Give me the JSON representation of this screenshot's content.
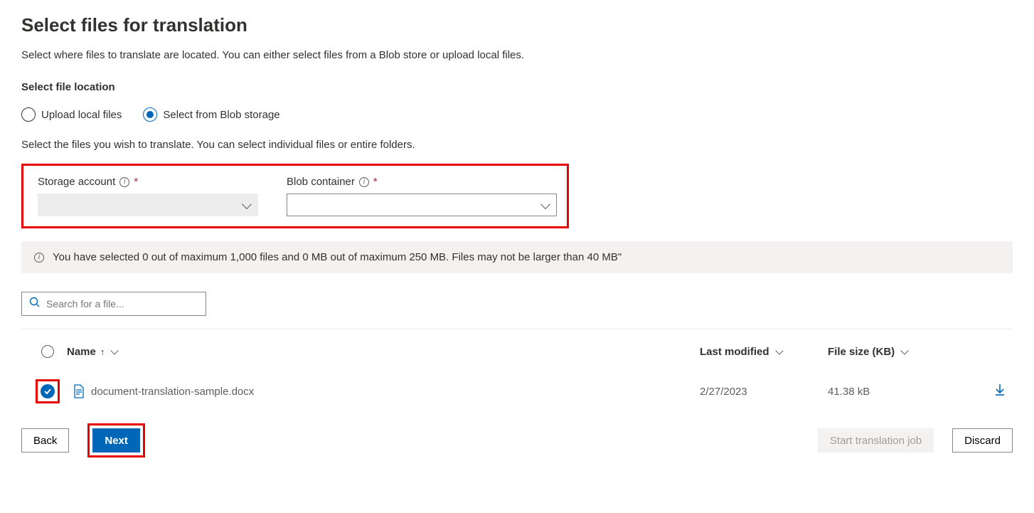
{
  "header": {
    "title": "Select files for translation",
    "description": "Select where files to translate are located. You can either select files from a Blob store or upload local files."
  },
  "location": {
    "label": "Select file location",
    "option_upload": "Upload local files",
    "option_blob": "Select from Blob storage"
  },
  "instruction": "Select the files you wish to translate. You can select individual files or entire folders.",
  "fields": {
    "storage_account_label": "Storage account",
    "blob_container_label": "Blob container"
  },
  "banner": "You have selected 0 out of maximum 1,000 files and 0 MB out of maximum 250 MB. Files may not be larger than 40 MB\"",
  "search_placeholder": "Search for a file...",
  "table": {
    "col_name": "Name",
    "col_modified": "Last modified",
    "col_size": "File size (KB)"
  },
  "row": {
    "filename": "document-translation-sample.docx",
    "modified": "2/27/2023",
    "size": "41.38 kB"
  },
  "footer": {
    "back": "Back",
    "next": "Next",
    "start": "Start translation job",
    "discard": "Discard"
  }
}
